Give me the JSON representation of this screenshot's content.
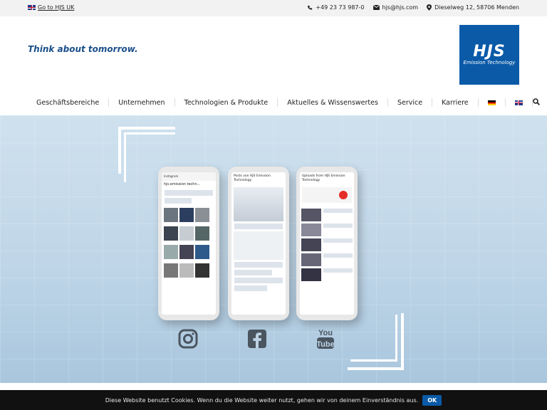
{
  "topbar": {
    "uk_link": "Go to HJS UK",
    "phone": "+49 23 73 987-0",
    "email": "hjs@hjs.com",
    "address": "Dieselweg 12, 58706 Menden"
  },
  "header": {
    "tagline": "Think about tomorrow.",
    "logo_text": "HJS",
    "logo_subtext": "Emission Technology",
    "logo_color": "#0a5aa8"
  },
  "nav": {
    "items": [
      "Geschäftsbereiche",
      "Unternehmen",
      "Technologien & Produkte",
      "Aktuelles & Wissenswertes",
      "Service",
      "Karriere"
    ],
    "icons": [
      "de-flag-icon",
      "uk-flag-icon",
      "search-icon"
    ]
  },
  "hero": {
    "phone_left_title": "hjs.emission techn...",
    "phone_middle_title": "Posts von HJS Emission Technology",
    "phone_right_title": "Uploads from HJS Emission Technology"
  },
  "social": [
    "instagram-icon",
    "facebook-icon",
    "youtube-icon"
  ],
  "cookie": {
    "text": "Diese Website benutzt Cookies. Wenn du die Website weiter nutzt, gehen wir von deinem Einverständnis aus.",
    "ok_label": "OK"
  }
}
